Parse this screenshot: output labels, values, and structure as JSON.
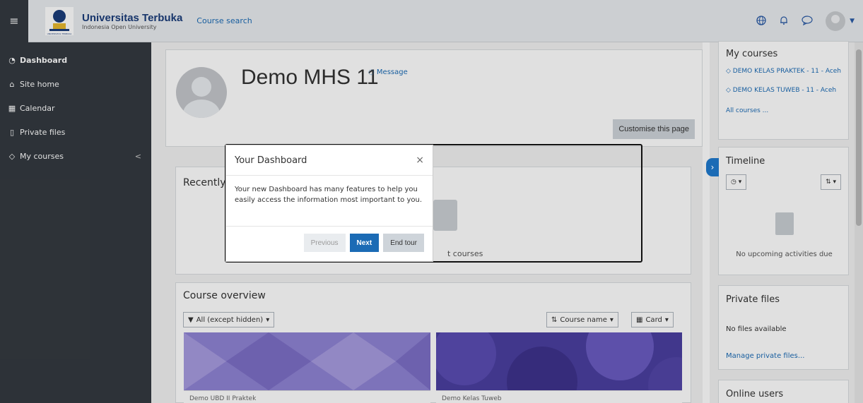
{
  "header": {
    "menu_icon": "hamburger-icon",
    "brand_title": "Universitas Terbuka",
    "brand_sub": "Indonesia Open University",
    "logo_caption": "UNIVERSITAS TERBUKA",
    "course_search": "Course search",
    "icons": [
      "globe-icon",
      "bell-icon",
      "chat-icon",
      "avatar",
      "caret-down-icon"
    ]
  },
  "sidebar": {
    "items": [
      {
        "label": "Dashboard",
        "icon": "dashboard-icon"
      },
      {
        "label": "Site home",
        "icon": "home-icon"
      },
      {
        "label": "Calendar",
        "icon": "calendar-icon"
      },
      {
        "label": "Private files",
        "icon": "file-icon"
      },
      {
        "label": "My courses",
        "icon": "graduation-cap-icon"
      }
    ],
    "collapse_glyph": "<"
  },
  "profile": {
    "name": "Demo MHS 11",
    "message": "Message",
    "customise": "Customise this page"
  },
  "recent": {
    "title": "Recently",
    "empty": "t courses"
  },
  "overview": {
    "title": "Course overview",
    "filter": "All (except hidden)",
    "sort": "Course name",
    "view": "Card",
    "course1": "Demo UBD II Praktek",
    "course2": "Demo Kelas Tuweb"
  },
  "right": {
    "my_courses_title": "My courses",
    "courses": [
      "DEMO KELAS PRAKTEK - 11 - Aceh",
      "DEMO KELAS TUWEB - 11 - Aceh"
    ],
    "all_courses": "All courses ...",
    "timeline_title": "Timeline",
    "timeline_empty": "No upcoming activities due",
    "private_files_title": "Private files",
    "no_files": "No files available",
    "manage_files": "Manage private files...",
    "online_users": "Online users"
  },
  "tour": {
    "title": "Your Dashboard",
    "close": "×",
    "body": "Your new Dashboard has many features to help you easily access the information most important to you.",
    "previous": "Previous",
    "next": "Next",
    "end": "End tour"
  },
  "colors": {
    "accent": "#1b6bb5",
    "sidebar_bg": "#343a40",
    "brand": "#1b3d7a"
  }
}
